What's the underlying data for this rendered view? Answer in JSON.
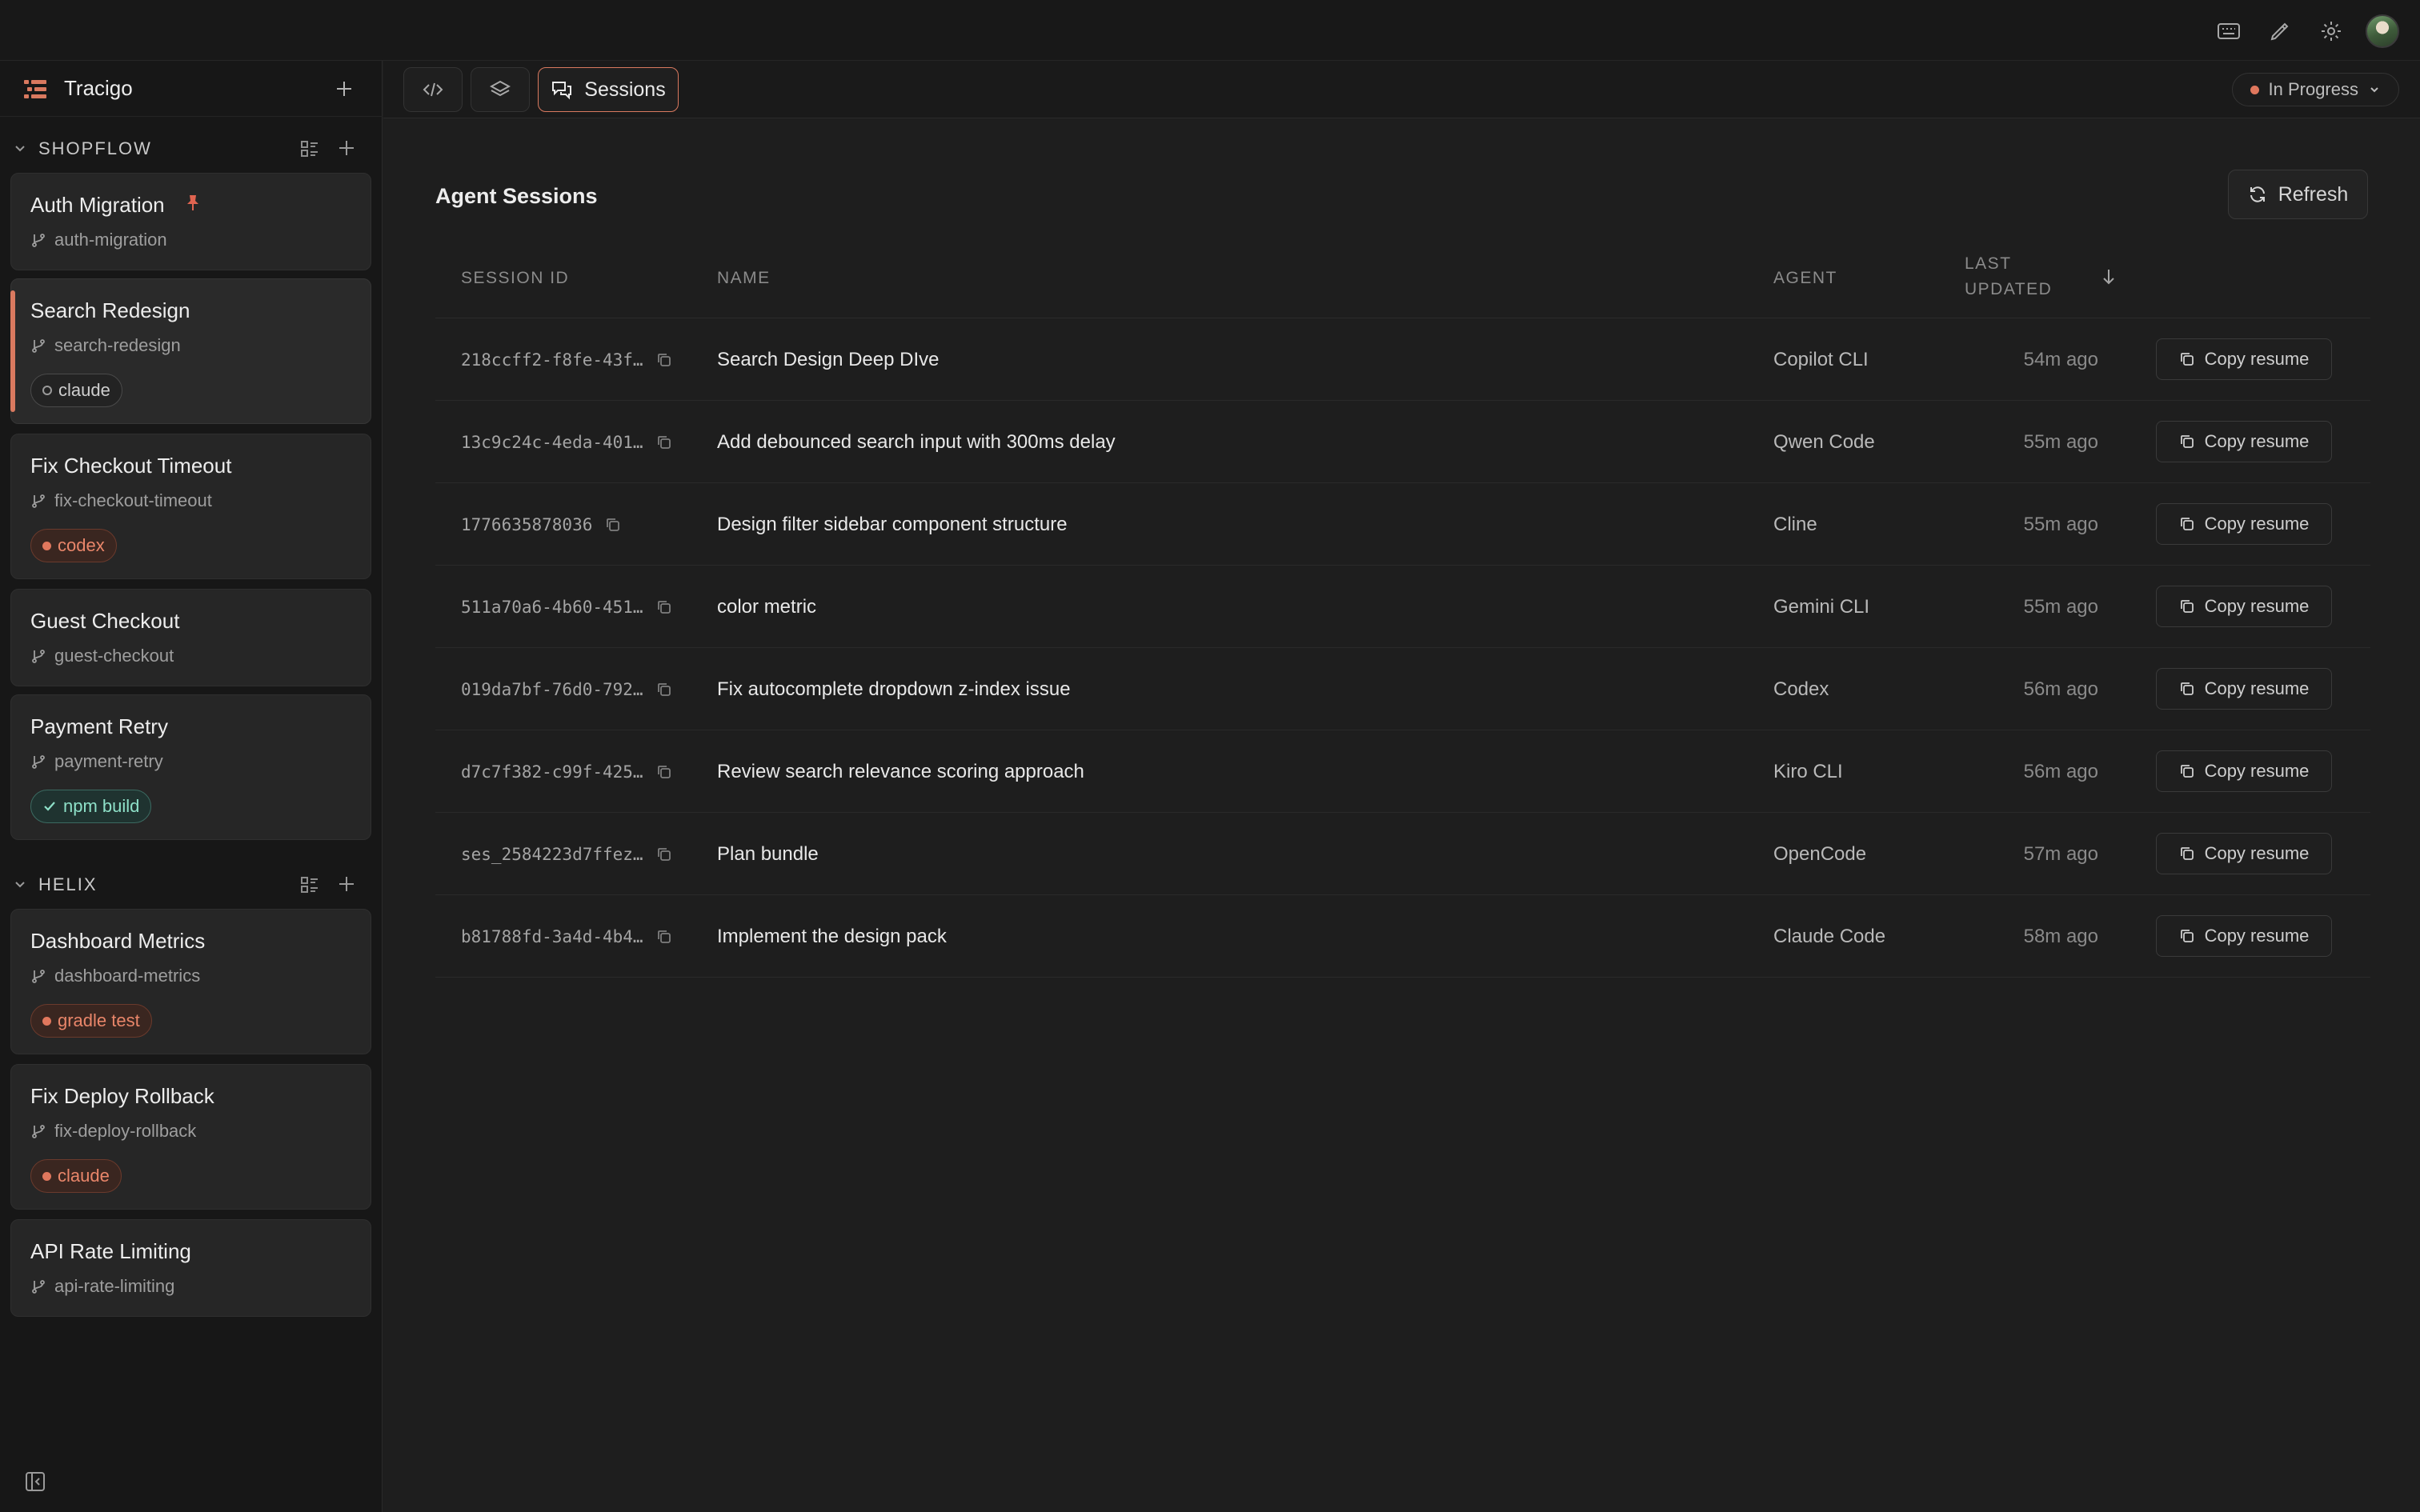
{
  "app": {
    "name": "Tracigo"
  },
  "sidebar": {
    "groups": [
      {
        "name": "SHOPFLOW",
        "items": [
          {
            "title": "Auth Migration",
            "branch": "auth-migration",
            "pinned": true
          },
          {
            "title": "Search Redesign",
            "branch": "search-redesign",
            "badge": "claude",
            "badge_style": "neutral",
            "active": true
          },
          {
            "title": "Fix Checkout Timeout",
            "branch": "fix-checkout-timeout",
            "badge": "codex",
            "badge_style": "orange"
          },
          {
            "title": "Guest Checkout",
            "branch": "guest-checkout"
          },
          {
            "title": "Payment Retry",
            "branch": "payment-retry",
            "badge": "npm build",
            "badge_style": "green"
          }
        ]
      },
      {
        "name": "HELIX",
        "items": [
          {
            "title": "Dashboard Metrics",
            "branch": "dashboard-metrics",
            "badge": "gradle test",
            "badge_style": "orange"
          },
          {
            "title": "Fix Deploy Rollback",
            "branch": "fix-deploy-rollback",
            "badge": "claude",
            "badge_style": "orange"
          },
          {
            "title": "API Rate Limiting",
            "branch": "api-rate-limiting"
          }
        ]
      }
    ]
  },
  "tabs": {
    "sessions_label": "Sessions",
    "status": "In Progress"
  },
  "page": {
    "title": "Agent Sessions",
    "refresh_label": "Refresh"
  },
  "table": {
    "columns": {
      "session_id": "SESSION ID",
      "name": "NAME",
      "agent": "AGENT",
      "last_updated_1": "LAST",
      "last_updated_2": "UPDATED"
    },
    "copy_label": "Copy resume",
    "rows": [
      {
        "id": "218ccff2-f8fe-43f…",
        "name": "Search Design Deep DIve",
        "agent": "Copilot CLI",
        "time": "54m ago"
      },
      {
        "id": "13c9c24c-4eda-401…",
        "name": "Add debounced search input with 300ms delay",
        "agent": "Qwen Code",
        "time": "55m ago"
      },
      {
        "id": "1776635878036",
        "name": "Design filter sidebar component structure",
        "agent": "Cline",
        "time": "55m ago"
      },
      {
        "id": "511a70a6-4b60-451…",
        "name": "color metric",
        "agent": "Gemini CLI",
        "time": "55m ago"
      },
      {
        "id": "019da7bf-76d0-792…",
        "name": "Fix autocomplete dropdown z-index issue",
        "agent": "Codex",
        "time": "56m ago"
      },
      {
        "id": "d7c7f382-c99f-425…",
        "name": "Review search relevance scoring approach",
        "agent": "Kiro CLI",
        "time": "56m ago"
      },
      {
        "id": "ses_2584223d7ffez…",
        "name": "Plan bundle",
        "agent": "OpenCode",
        "time": "57m ago"
      },
      {
        "id": "b81788fd-3a4d-4b4…",
        "name": "Implement the design pack",
        "agent": "Claude Code",
        "time": "58m ago"
      }
    ]
  },
  "colors": {
    "accent": "#d9795f",
    "background": "#1e1e1e",
    "sidebar": "#171717"
  },
  "icons": [
    "keyboard-icon",
    "pencil-icon",
    "gear-icon",
    "avatar",
    "app-logo-icon",
    "plus-icon",
    "chevron-down-icon",
    "list-options-icon",
    "git-branch-icon",
    "pin-icon",
    "code-icon",
    "layers-icon",
    "chat-icon",
    "refresh-icon",
    "copy-icon",
    "arrow-down-icon",
    "sidebar-toggle-icon"
  ]
}
